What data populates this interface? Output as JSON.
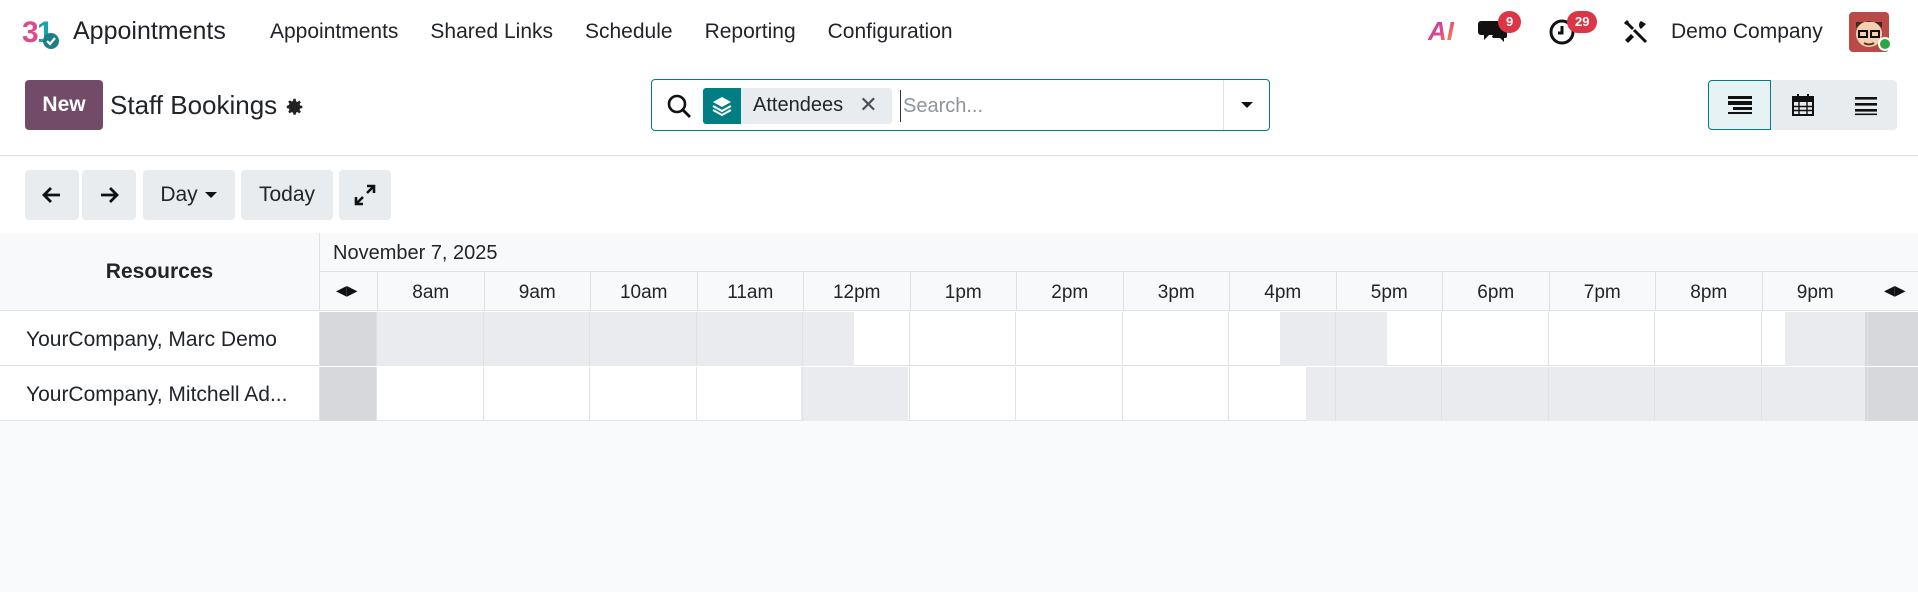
{
  "app": {
    "name": "Appointments"
  },
  "menu": [
    "Appointments",
    "Shared Links",
    "Schedule",
    "Reporting",
    "Configuration"
  ],
  "systray": {
    "ai_label": "AI",
    "messages_count": "9",
    "activities_count": "29",
    "company": "Demo Company"
  },
  "control": {
    "new_label": "New",
    "title": "Staff Bookings",
    "facet_label": "Attendees",
    "facet_close": "✕",
    "search_placeholder": "Search..."
  },
  "toolbar": {
    "scale_label": "Day",
    "today_label": "Today"
  },
  "gantt": {
    "resources_header": "Resources",
    "date": "November 7, 2025",
    "hours": [
      "8am",
      "9am",
      "10am",
      "11am",
      "12pm",
      "1pm",
      "2pm",
      "3pm",
      "4pm",
      "5pm",
      "6pm",
      "7pm",
      "8pm",
      "9pm"
    ],
    "rows": [
      {
        "label": "YourCompany, Marc Demo"
      },
      {
        "label": "YourCompany, Mitchell Ad..."
      }
    ]
  },
  "colors": {
    "accent": "#017e84",
    "brand": "#714b67",
    "badge": "#dc3545"
  }
}
